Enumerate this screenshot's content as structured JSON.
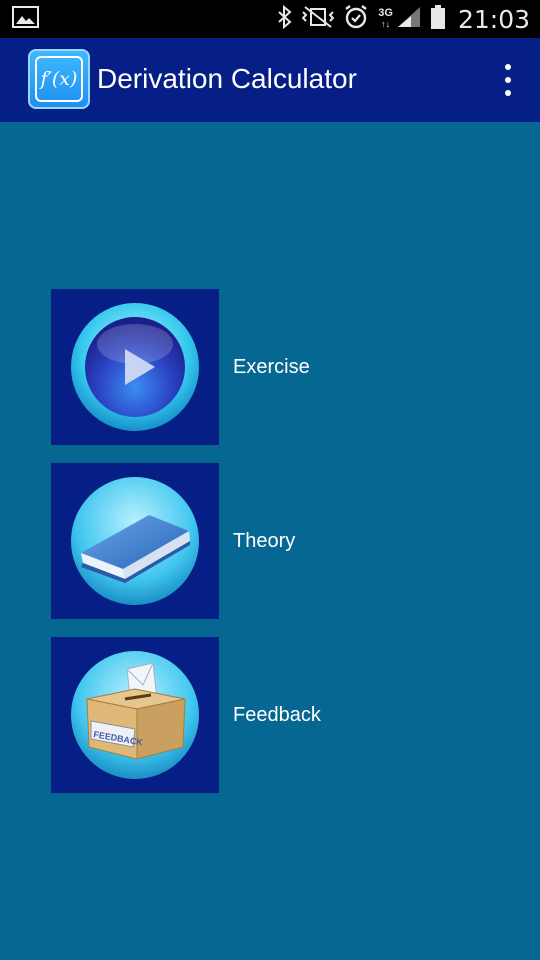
{
  "status_bar": {
    "time": "21:03",
    "network_type": "3G",
    "icons": [
      "image-notification-icon",
      "bluetooth-icon",
      "vibrate-icon",
      "alarm-icon",
      "signal-icon",
      "battery-icon"
    ]
  },
  "action_bar": {
    "app_icon_text": "f′(x)",
    "title": "Derivation Calculator",
    "overflow_icon": "more-vert-icon"
  },
  "menu": {
    "items": [
      {
        "label": "Exercise",
        "icon": "play-icon"
      },
      {
        "label": "Theory",
        "icon": "book-icon"
      },
      {
        "label": "Feedback",
        "icon": "feedback-box-icon"
      }
    ]
  },
  "feedback_box_text": "FEEDBACK",
  "colors": {
    "background": "#066892",
    "action_bar": "#061f86",
    "tile": "#061f86",
    "status_bar": "#000000",
    "text": "#ffffff"
  }
}
